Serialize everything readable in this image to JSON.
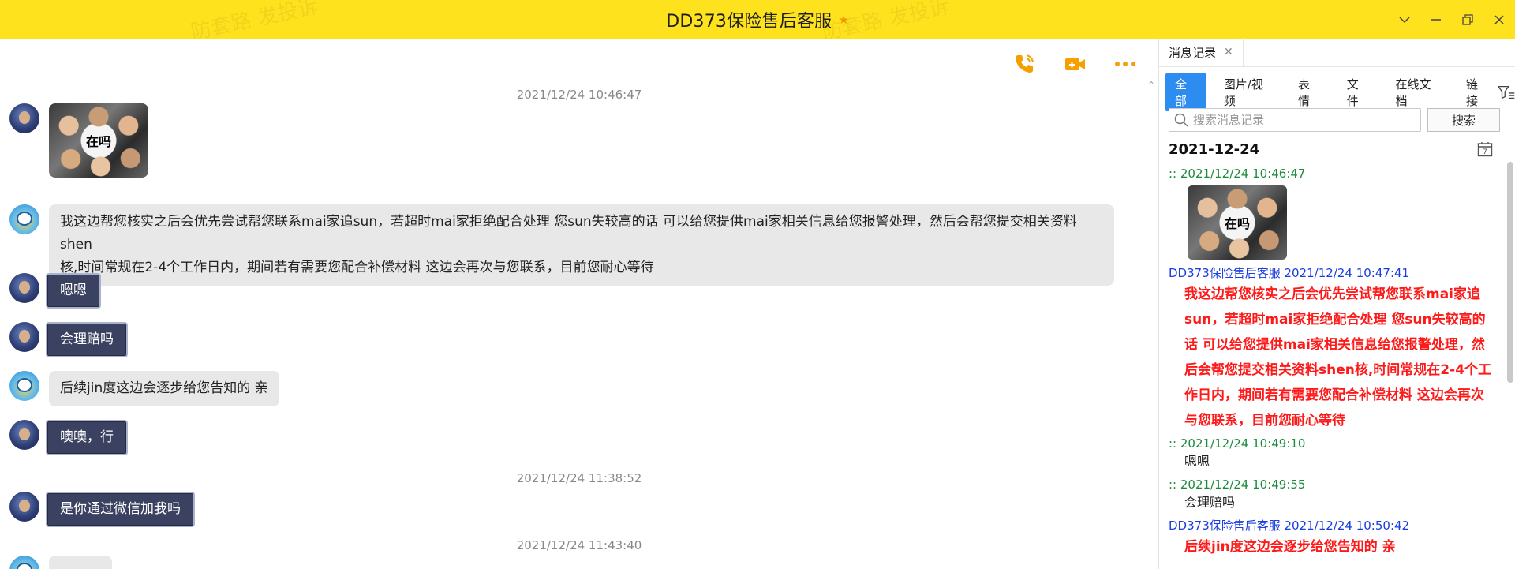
{
  "window": {
    "title": "DD373保险售后客服",
    "watermark_text": "防套路 发投诉",
    "accent_color": "#ffe21e"
  },
  "chat": {
    "toolbar": {
      "voice_call_icon": "phone-icon",
      "video_call_icon": "video-camera-icon",
      "more_icon": "more-dots-icon",
      "icon_color": "#f5a000"
    },
    "timestamps": [
      "2021/12/24 10:46:47",
      "2021/12/24 11:38:52",
      "2021/12/24 11:43:40"
    ],
    "messages": [
      {
        "sender": "me",
        "type": "sticker",
        "text": "在吗"
      },
      {
        "sender": "cs",
        "type": "text",
        "lines": [
          "我这边帮您核实之后会优先尝试帮您联系mai家追sun，若超时mai家拒绝配合处理  您sun失较高的话 可以给您提供mai家相关信息给您报警处理，然后会帮您提交相关资料shen",
          "核,时间常规在2-4个工作日内，期间若有需要您配合补偿材料  这边会再次与您联系，目前您耐心等待"
        ]
      },
      {
        "sender": "me",
        "type": "text",
        "text": "嗯嗯"
      },
      {
        "sender": "me",
        "type": "text",
        "text": "会理赔吗"
      },
      {
        "sender": "cs",
        "type": "text",
        "text": "后续jin度这边会逐步给您告知的 亲"
      },
      {
        "sender": "me",
        "type": "text",
        "text": "噢噢，行"
      },
      {
        "sender": "me",
        "type": "text",
        "text": "是你通过微信加我吗"
      }
    ]
  },
  "panel": {
    "tab_label": "消息记录",
    "filters": [
      "全部",
      "图片/视频",
      "表情",
      "文件",
      "在线文档",
      "链接"
    ],
    "active_filter": "全部",
    "search_placeholder": "搜索消息记录",
    "search_button": "搜索",
    "date": "2021-12-24",
    "calendar_day": "7",
    "records": [
      {
        "meta": ":: 2021/12/24 10:46:47",
        "sender": "me",
        "sticker_text": "在吗"
      },
      {
        "meta": "DD373保险售后客服 2021/12/24 10:47:41",
        "sender": "cs",
        "lines": [
          "我这边帮您核实之后会优先尝试帮您联系mai家追",
          "sun，若超时mai家拒绝配合处理  您sun失较高的",
          "话 可以给您提供mai家相关信息给您报警处理，然",
          "后会帮您提交相关资料shen核,时间常规在2-4个工",
          "作日内，期间若有需要您配合补偿材料  这边会再次",
          "与您联系，目前您耐心等待"
        ]
      },
      {
        "meta": ":: 2021/12/24 10:49:10",
        "sender": "me",
        "text": "嗯嗯"
      },
      {
        "meta": ":: 2021/12/24 10:49:55",
        "sender": "me",
        "text": "会理赔吗"
      },
      {
        "meta": "DD373保险售后客服 2021/12/24 10:50:42",
        "sender": "cs",
        "lines": [
          "后续jin度这边会逐步给您告知的 亲"
        ]
      }
    ]
  }
}
